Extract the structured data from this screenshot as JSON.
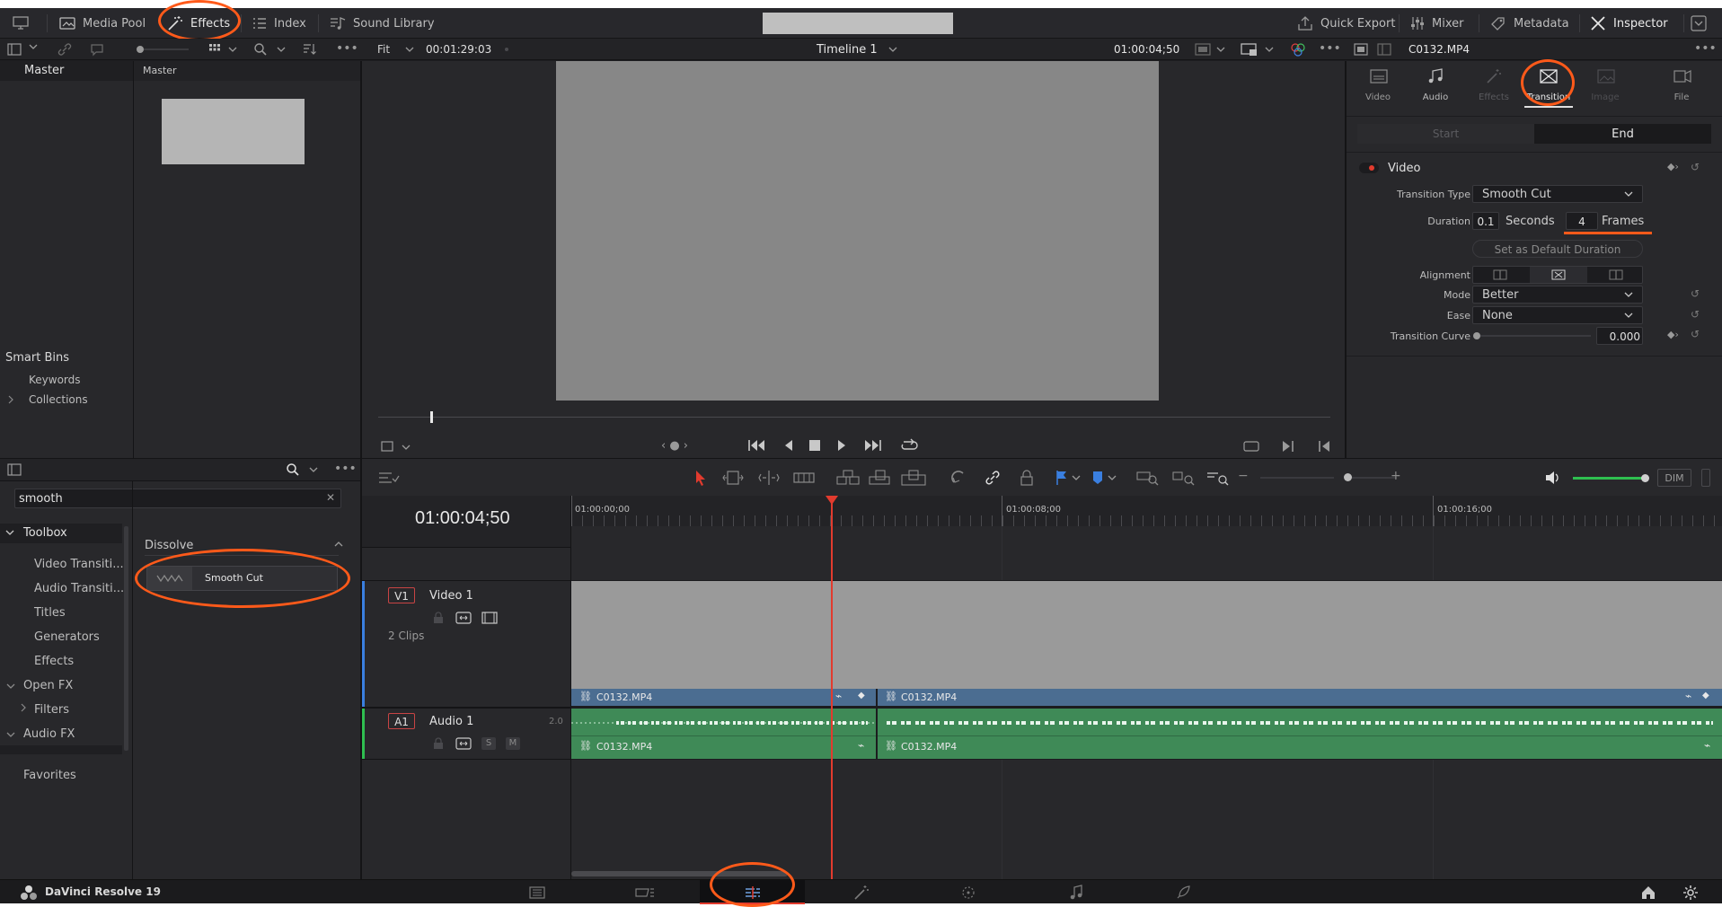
{
  "topbar": {
    "media_pool": "Media Pool",
    "effects": "Effects",
    "index": "Index",
    "sound_library": "Sound Library",
    "quick_export": "Quick Export",
    "mixer": "Mixer",
    "metadata": "Metadata",
    "inspector": "Inspector"
  },
  "viewer": {
    "fit": "Fit",
    "source_timecode": "00:01:29:03",
    "timeline_name": "Timeline 1",
    "timecode": "01:00:04;50"
  },
  "media_pool": {
    "left_bin": "Master",
    "right_header": "Master",
    "smart_bins": "Smart Bins",
    "keywords": "Keywords",
    "collections": "Collections"
  },
  "effects": {
    "search_value": "smooth",
    "toolbox": "Toolbox",
    "items": [
      "Video Transiti...",
      "Audio Transiti...",
      "Titles",
      "Generators",
      "Effects"
    ],
    "open_fx": "Open FX",
    "filters": "Filters",
    "audio_fx": "Audio FX",
    "favorites": "Favorites",
    "category": "Dissolve",
    "result": "Smooth Cut"
  },
  "inspector": {
    "clip_name": "C0132.MP4",
    "tabs": [
      "Video",
      "Audio",
      "Effects",
      "Transition",
      "Image",
      "File"
    ],
    "active_tab": "Transition",
    "start": "Start",
    "end": "End",
    "section": "Video",
    "transition_type_label": "Transition Type",
    "transition_type": "Smooth Cut",
    "duration_label": "Duration",
    "duration_seconds": "0.1",
    "seconds_label": "Seconds",
    "duration_frames": "4",
    "frames_label": "Frames",
    "set_default": "Set as Default Duration",
    "alignment_label": "Alignment",
    "mode_label": "Mode",
    "mode": "Better",
    "ease_label": "Ease",
    "ease": "None",
    "curve_label": "Transition Curve",
    "curve_value": "0.000"
  },
  "timeline": {
    "timecode": "01:00:04;50",
    "ruler": [
      "01:00:00;00",
      "01:00:08;00",
      "01:00:16;00"
    ],
    "v1_tag": "V1",
    "v1_name": "Video 1",
    "v1_clips": "2 Clips",
    "a1_tag": "A1",
    "a1_name": "Audio 1",
    "a1_channels": "2.0",
    "clip_a": "C0132.MP4",
    "clip_b": "C0132.MP4",
    "audio_clip_a": "C0132.MP4",
    "audio_clip_b": "C0132.MP4",
    "dim": "DIM",
    "solo": "S",
    "mute": "M"
  },
  "footer": {
    "app_name": "DaVinci Resolve 19"
  },
  "colors": {
    "annotation": "#ff5a1a",
    "playhead": "#e23b2e",
    "video_clip": "#4b6d91",
    "audio_clip": "#3f8a57"
  }
}
